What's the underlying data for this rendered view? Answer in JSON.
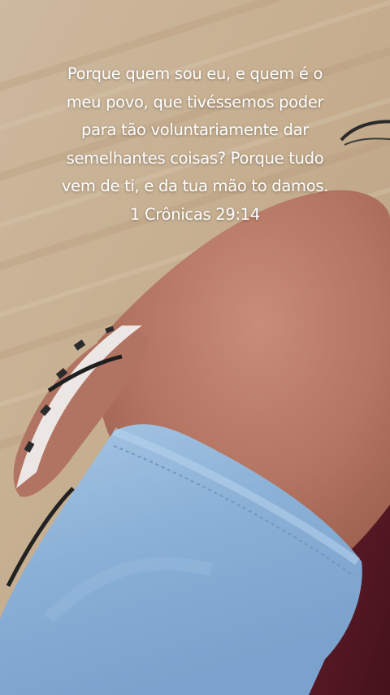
{
  "story": {
    "verse_lines": [
      "Porque quem sou eu, e quem é o",
      "meu povo, que tivéssemos poder",
      "para tão voluntariamente dar",
      "semelhantes coisas? Porque tudo",
      "vem de ti, e da tua mão to damos."
    ],
    "reference": "1 Crônicas 29:14"
  },
  "colors": {
    "text": "#ffffff",
    "wood_floor": "#c9b193",
    "skin": "#b77a66",
    "denim": "#8db4d8",
    "fabric_maroon": "#5a1a22"
  }
}
